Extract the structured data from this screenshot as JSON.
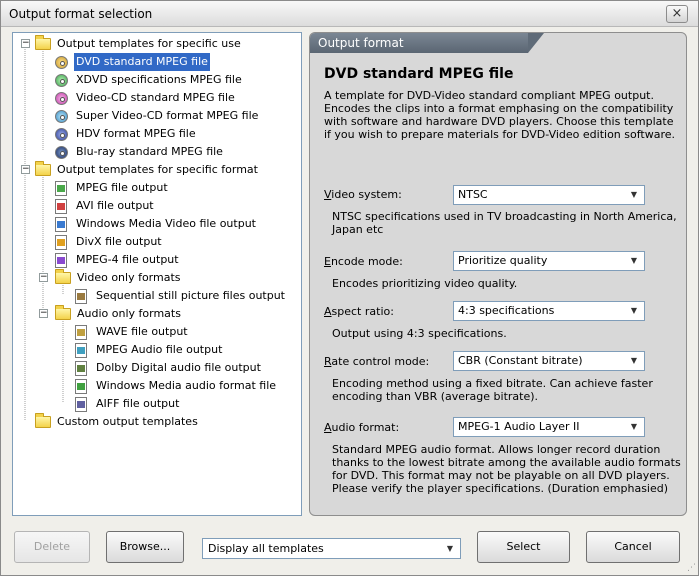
{
  "window": {
    "title": "Output format selection",
    "close_symbol": "×"
  },
  "tree": {
    "groups": [
      {
        "label": "Output templates for specific use",
        "items": [
          {
            "label": "DVD standard MPEG file",
            "icon": "dvd-disc-icon",
            "selected": true
          },
          {
            "label": "XDVD specifications MPEG file",
            "icon": "xdvd-disc-icon"
          },
          {
            "label": "Video-CD standard MPEG file",
            "icon": "vcd-disc-icon"
          },
          {
            "label": "Super Video-CD format MPEG file",
            "icon": "svcd-disc-icon"
          },
          {
            "label": "HDV format MPEG file",
            "icon": "hdv-disc-icon"
          },
          {
            "label": "Blu-ray standard MPEG file",
            "icon": "bluray-disc-icon"
          }
        ]
      },
      {
        "label": "Output templates for specific format",
        "items": [
          {
            "label": "MPEG file output",
            "icon": "mpeg-file-icon"
          },
          {
            "label": "AVI file output",
            "icon": "avi-file-icon"
          },
          {
            "label": "Windows Media Video file output",
            "icon": "wmv-file-icon"
          },
          {
            "label": "DivX file output",
            "icon": "divx-file-icon"
          },
          {
            "label": "MPEG-4 file output",
            "icon": "mpeg4-file-icon"
          }
        ],
        "subgroups": [
          {
            "label": "Video only formats",
            "items": [
              {
                "label": "Sequential still picture files output",
                "icon": "still-picture-file-icon"
              }
            ]
          },
          {
            "label": "Audio only formats",
            "items": [
              {
                "label": "WAVE file output",
                "icon": "wave-file-icon"
              },
              {
                "label": "MPEG Audio file output",
                "icon": "mpeg-audio-file-icon"
              },
              {
                "label": "Dolby Digital audio file output",
                "icon": "dolby-file-icon"
              },
              {
                "label": "Windows Media audio format file",
                "icon": "wma-file-icon"
              },
              {
                "label": "AIFF file output",
                "icon": "aiff-file-icon"
              }
            ]
          }
        ]
      },
      {
        "label": "Custom output templates",
        "items": []
      }
    ]
  },
  "details": {
    "header": "Output format",
    "title": "DVD standard MPEG file",
    "description": "A template for DVD-Video standard compliant MPEG output. Encodes the clips into a format emphasing on the compatibility with software and hardware DVD players. Choose this template if you wish to prepare materials for DVD-Video edition software.",
    "fields": [
      {
        "label_mnemonic": "V",
        "label_rest": "ideo system:",
        "value": "NTSC",
        "note": "NTSC specifications used in TV broadcasting in North America, Japan etc"
      },
      {
        "label_mnemonic": "E",
        "label_rest": "ncode mode:",
        "value": "Prioritize quality",
        "note": "Encodes prioritizing video quality."
      },
      {
        "label_mnemonic": "A",
        "label_rest": "spect ratio:",
        "value": "4:3 specifications",
        "note": "Output using 4:3 specifications."
      },
      {
        "label_mnemonic": "R",
        "label_rest": "ate control mode:",
        "value": "CBR (Constant bitrate)",
        "note": "Encoding method using a fixed bitrate. Can achieve faster encoding than VBR (average bitrate)."
      },
      {
        "label_mnemonic": "A",
        "label_rest": "udio format:",
        "value": "MPEG-1 Audio Layer II",
        "note": "Standard MPEG audio format. Allows longer record duration thanks to the lowest bitrate among the available audio formats for DVD. This format may not be playable on all DVD players. Please verify the player specifications. (Duration emphasied)"
      }
    ]
  },
  "buttons": {
    "delete": "Delete",
    "browse": "Browse...",
    "filter_value": "Display all templates",
    "select": "Select",
    "cancel": "Cancel"
  },
  "colors": {
    "selection": "#3169c6",
    "header_bg": "#6a7581",
    "panel_bg": "#d8d8d8"
  }
}
